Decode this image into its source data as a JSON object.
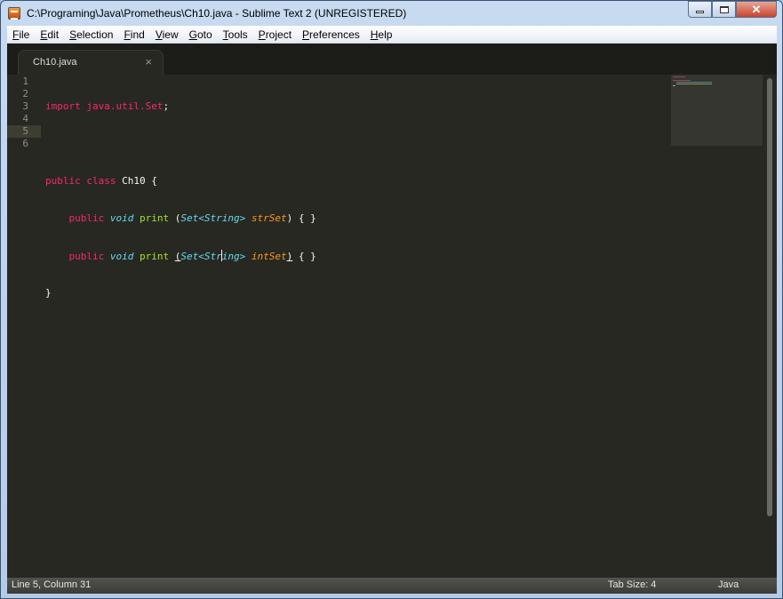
{
  "window": {
    "title": "C:\\Programing\\Java\\Prometheus\\Ch10.java - Sublime Text 2 (UNREGISTERED)",
    "close_glyph": "✕"
  },
  "menu": [
    {
      "label": "File"
    },
    {
      "label": "Edit"
    },
    {
      "label": "Selection"
    },
    {
      "label": "Find"
    },
    {
      "label": "View"
    },
    {
      "label": "Goto"
    },
    {
      "label": "Tools"
    },
    {
      "label": "Project"
    },
    {
      "label": "Preferences"
    },
    {
      "label": "Help"
    }
  ],
  "tab": {
    "label": "Ch10.java",
    "close_glyph": "×"
  },
  "editor": {
    "line_numbers": [
      "1",
      "2",
      "3",
      "4",
      "5",
      "6"
    ],
    "current_line": 5,
    "lines": [
      {
        "t1": "import",
        "t2": " java.util.Set",
        "t3": ";"
      },
      {},
      {
        "t1": "public",
        "t2": " ",
        "t3": "class",
        "t4": " Ch10 {"
      },
      {
        "t0": "    ",
        "t1": "public",
        "t2": " ",
        "t3": "void",
        "t4": " ",
        "t5": "print",
        "t6": " (",
        "t7": "Set<String>",
        "t8": " ",
        "t9": "strSet",
        "t10": ") { }"
      },
      {
        "t0": "    ",
        "t1": "public",
        "t2": " ",
        "t3": "void",
        "t4": " ",
        "t5": "print",
        "t6": " ",
        "t6b": "(",
        "t7a": "Set<Str",
        "t7b": "ing>",
        "t8": " ",
        "t9": "intSet",
        "t10a": ")",
        "t10b": " { }"
      },
      {
        "t1": "}"
      }
    ]
  },
  "status": {
    "position": "Line 5, Column 31",
    "tab_size": "Tab Size: 4",
    "syntax": "Java"
  },
  "colors": {
    "background": "#272822",
    "keyword": "#f92672",
    "storage_type": "#66d9ef",
    "function": "#a6e22e",
    "parameter": "#fd971f",
    "plain": "#f8f8f2"
  }
}
